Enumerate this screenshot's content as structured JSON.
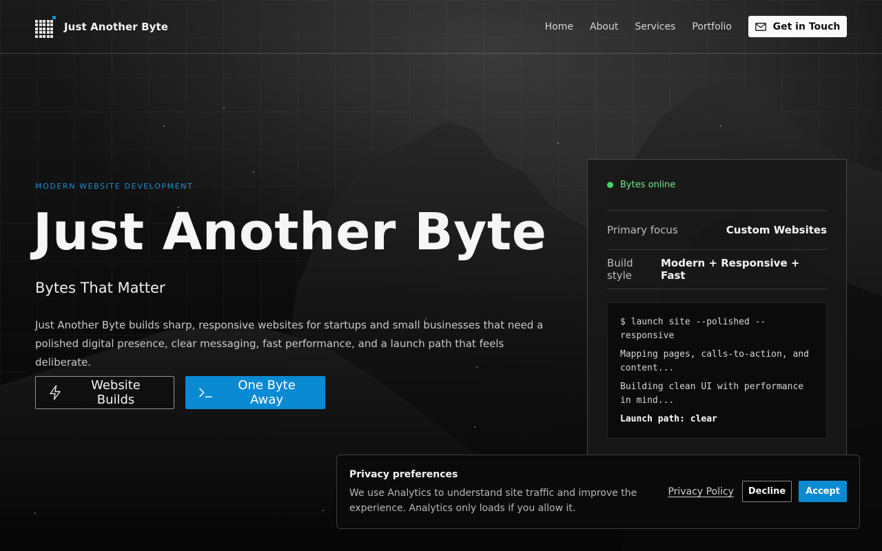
{
  "header": {
    "brand_name": "Just Another Byte",
    "logo_icon": "grid-logo-icon",
    "nav": [
      {
        "label": "Home"
      },
      {
        "label": "About"
      },
      {
        "label": "Services"
      },
      {
        "label": "Portfolio"
      }
    ],
    "cta_label": "Get in Touch",
    "cta_icon": "mail-icon"
  },
  "hero": {
    "eyebrow": "MODERN WEBSITE DEVELOPMENT",
    "title": "Just Another Byte",
    "tagline": "Bytes That Matter",
    "description": "Just Another Byte builds sharp, responsive websites for startups and small businesses that need a polished digital presence, clear messaging, fast performance, and a launch path that feels deliberate.",
    "primary_button": {
      "label": "Website Builds",
      "icon": "lightning-icon"
    },
    "secondary_button": {
      "label": "One Byte Away",
      "icon": "terminal-icon"
    }
  },
  "status_card": {
    "status": "Bytes online",
    "rows": [
      {
        "key": "Primary focus",
        "value": "Custom Websites"
      },
      {
        "key": "Build style",
        "value": "Modern + Responsive + Fast"
      }
    ],
    "terminal": [
      "$ launch site --polished --responsive",
      "Mapping pages, calls-to-action, and content...",
      "Building clean UI with performance in mind...",
      "Launch path: clear"
    ]
  },
  "privacy": {
    "title": "Privacy preferences",
    "text": "We use Analytics to understand site traffic and improve the experience. Analytics only loads if you allow it.",
    "policy_link": "Privacy Policy",
    "decline_label": "Decline",
    "accept_label": "Accept"
  },
  "colors": {
    "accent": "#0a8ad2",
    "status_green": "#45d36a",
    "background": "#050505"
  }
}
